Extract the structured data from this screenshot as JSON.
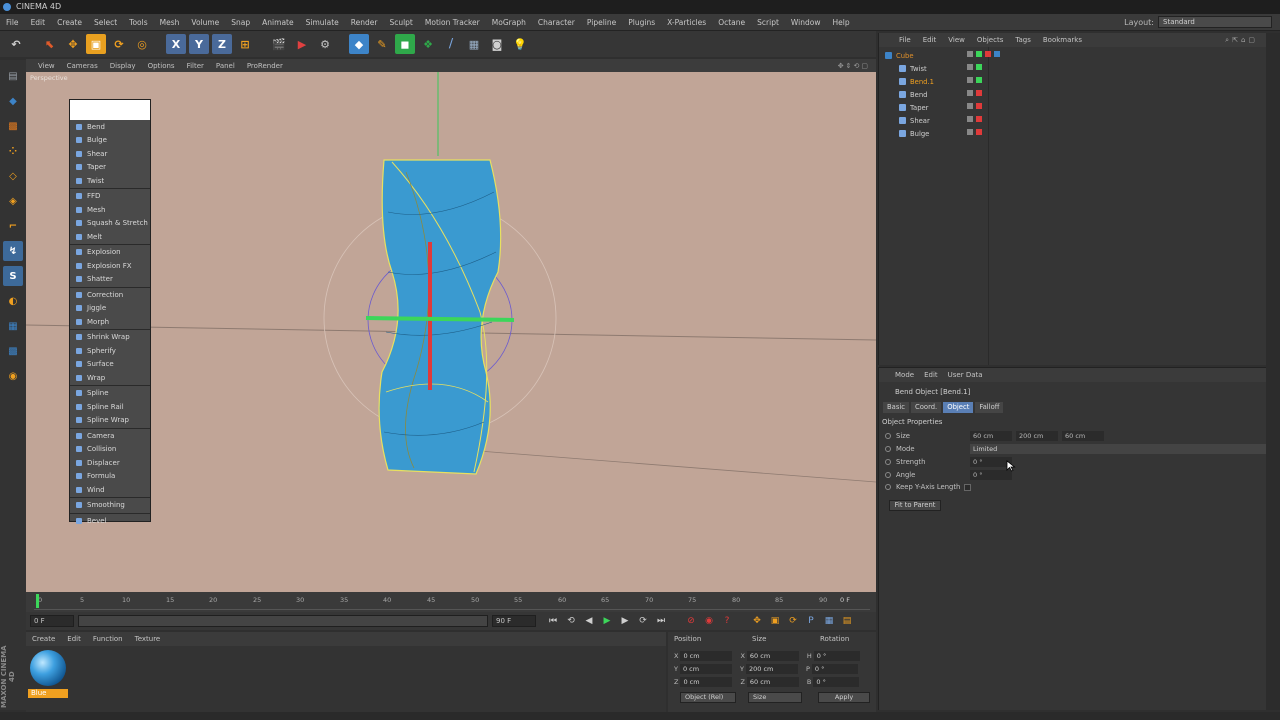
{
  "window": {
    "title": "CINEMA 4D"
  },
  "menu": [
    "File",
    "Edit",
    "Create",
    "Select",
    "Tools",
    "Mesh",
    "Volume",
    "Snap",
    "Animate",
    "Simulate",
    "Render",
    "Sculpt",
    "Motion Tracker",
    "MoGraph",
    "Character",
    "Pipeline",
    "Plugins",
    "X-Particles",
    "Octane",
    "Script",
    "Window",
    "Help"
  ],
  "layout": {
    "label": "Layout:",
    "value": "Standard"
  },
  "viewport": {
    "menu": [
      "View",
      "Cameras",
      "Display",
      "Options",
      "Filter",
      "Panel",
      "ProRender"
    ],
    "camera_label": "Perspective"
  },
  "deformer_menu": {
    "groups": [
      [
        "Bend",
        "Bulge",
        "Shear",
        "Taper",
        "Twist"
      ],
      [
        "FFD",
        "Mesh",
        "Squash & Stretch",
        "Melt"
      ],
      [
        "Explosion",
        "Explosion FX",
        "Shatter"
      ],
      [
        "Correction",
        "Jiggle",
        "Morph"
      ],
      [
        "Shrink Wrap",
        "Spherify",
        "Surface",
        "Wrap"
      ],
      [
        "Spline",
        "Spline Rail",
        "Spline Wrap"
      ],
      [
        "Camera",
        "Collision",
        "Displacer",
        "Formula",
        "Wind"
      ],
      [
        "Smoothing"
      ],
      [
        "Bevel"
      ]
    ]
  },
  "timeline": {
    "ticks": [
      "0",
      "5",
      "10",
      "15",
      "20",
      "25",
      "30",
      "35",
      "40",
      "45",
      "50",
      "55",
      "60",
      "65",
      "70",
      "75",
      "80",
      "85",
      "90"
    ],
    "end_frame": "0 F",
    "start_field": "0 F",
    "end_field": "90 F"
  },
  "material_manager": {
    "menu": [
      "Create",
      "Edit",
      "Function",
      "Texture"
    ],
    "material_name": "Blue"
  },
  "coordinates": {
    "headers": [
      "Position",
      "Size",
      "Rotation"
    ],
    "rows": [
      {
        "axis": "X",
        "pos": "0 cm",
        "size_axis": "X",
        "size": "60 cm",
        "rot_axis": "H",
        "rot": "0 °"
      },
      {
        "axis": "Y",
        "pos": "0 cm",
        "size_axis": "Y",
        "size": "200 cm",
        "rot_axis": "P",
        "rot": "0 °"
      },
      {
        "axis": "Z",
        "pos": "0 cm",
        "size_axis": "Z",
        "size": "60 cm",
        "rot_axis": "B",
        "rot": "0 °"
      }
    ],
    "mode": "Object (Rel)",
    "size_mode": "Size",
    "apply": "Apply"
  },
  "maxon": "MAXON CINEMA 4D",
  "object_manager": {
    "menu": [
      "File",
      "Edit",
      "View",
      "Objects",
      "Tags",
      "Bookmarks"
    ],
    "objects": [
      {
        "name": "Cube",
        "color": "#e0902a"
      },
      {
        "name": "Twist",
        "color": "#cfcfcf"
      },
      {
        "name": "Bend.1",
        "color": "#f0a020"
      },
      {
        "name": "Bend",
        "color": "#cfcfcf"
      },
      {
        "name": "Taper",
        "color": "#cfcfcf"
      },
      {
        "name": "Shear",
        "color": "#cfcfcf"
      },
      {
        "name": "Bulge",
        "color": "#cfcfcf"
      }
    ]
  },
  "attribute_manager": {
    "menu": [
      "Mode",
      "Edit",
      "User Data"
    ],
    "object_title": "Bend Object [Bend.1]",
    "tabs": [
      "Basic",
      "Coord.",
      "Object",
      "Falloff"
    ],
    "active_tab": "Object",
    "section": "Object Properties",
    "size_label": "Size",
    "size": [
      "60 cm",
      "200 cm",
      "60 cm"
    ],
    "mode_label": "Mode",
    "mode_value": "Limited",
    "strength_label": "Strength",
    "strength_value": "0 °",
    "angle_label": "Angle",
    "angle_value": "0 °",
    "keep_label": "Keep Y-Axis Length",
    "fit_button": "Fit to Parent"
  },
  "colors": {
    "viewport_bg": "#c1a597",
    "object_blue": "#3a9ad0",
    "accent": "#5a7fb5"
  }
}
